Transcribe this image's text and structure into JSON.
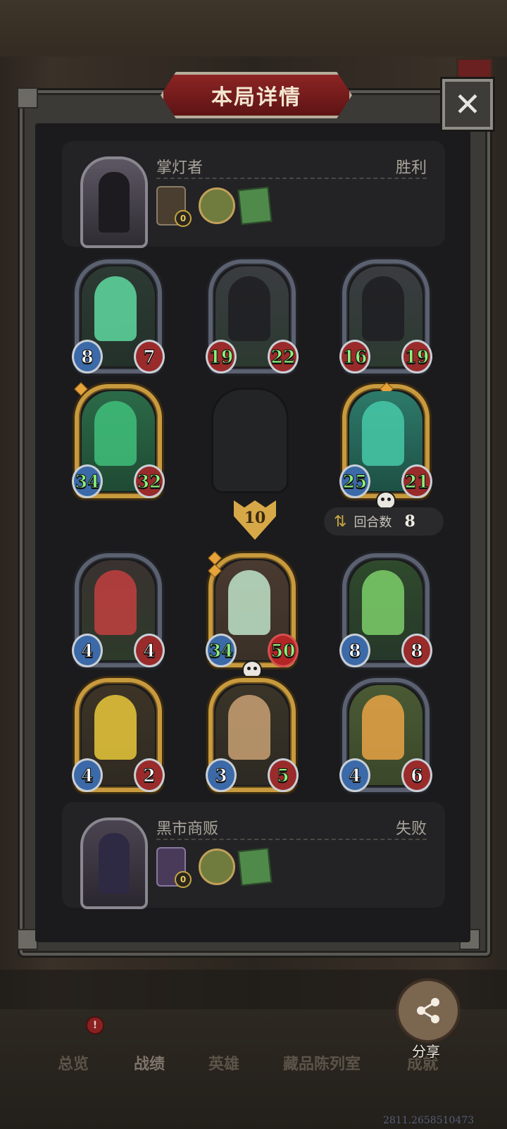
{
  "dialog": {
    "title": "本局详情",
    "close_label": "✕"
  },
  "player_top": {
    "name": "掌灯者",
    "result": "胜利",
    "lantern_level": "0"
  },
  "player_bottom": {
    "name": "黑市商贩",
    "result": "失败",
    "lantern_level": "0"
  },
  "top_board": {
    "row1": [
      {
        "atk": "8",
        "hp": "7"
      },
      {
        "atk": "19",
        "hp": "22"
      },
      {
        "atk": "16",
        "hp": "19"
      }
    ],
    "row2": [
      {
        "atk": "34",
        "hp": "32"
      },
      {
        "atk": "25",
        "hp": "21"
      }
    ]
  },
  "round": {
    "arrow_value": "10",
    "turns_label": "回合数",
    "turns_value": "8"
  },
  "bottom_board": {
    "row1": [
      {
        "atk": "4",
        "hp": "4"
      },
      {
        "atk": "34",
        "hp": "50"
      },
      {
        "atk": "8",
        "hp": "8"
      }
    ],
    "row2": [
      {
        "atk": "4",
        "hp": "2"
      },
      {
        "atk": "3",
        "hp": "5"
      },
      {
        "atk": "4",
        "hp": "6"
      }
    ]
  },
  "share": {
    "label": "分享"
  },
  "nav": {
    "items": [
      "总览",
      "战绩",
      "英雄",
      "藏品陈列室",
      "成就"
    ],
    "badge": "!"
  },
  "footer": {
    "coords": "2811.2658510473"
  },
  "colors": {
    "frame": "#3b3a37",
    "inner": "#1b1b1d",
    "title_red": "#8c2424",
    "gold": "#c89a3e",
    "ghost_green": "#3fbf7a",
    "atk_blue": "#3c6aa8",
    "hp_red": "#9a2b2b"
  }
}
